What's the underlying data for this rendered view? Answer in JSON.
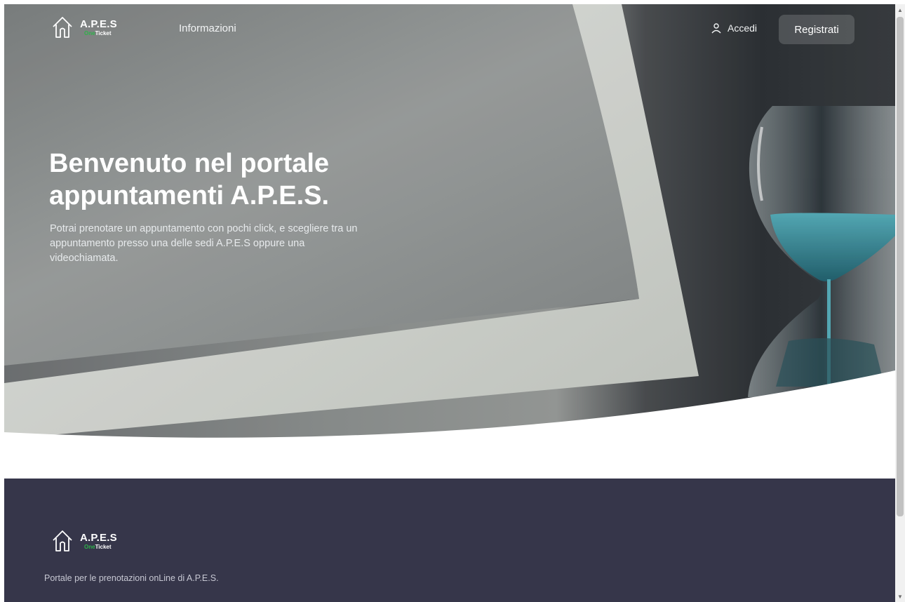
{
  "header": {
    "brand": {
      "name": "A.P.E.S",
      "sub_one": "One",
      "sub_ticket": "Ticket"
    },
    "nav_link": "Informazioni",
    "login_label": "Accedi",
    "register_label": "Registrati"
  },
  "hero": {
    "title_line1": "Benvenuto nel portale",
    "title_line2": "appuntamenti A.P.E.S.",
    "description": "Potrai prenotare un appuntamento con pochi click, e scegliere tra un appuntamento presso una delle sedi A.P.E.S oppure una videochiamata."
  },
  "footer": {
    "brand": {
      "name": "A.P.E.S",
      "sub_one": "One",
      "sub_ticket": "Ticket"
    },
    "description": "Portale per le prenotazioni onLine di A.P.E.S."
  },
  "colors": {
    "accent_green": "#2fb24a",
    "footer_bg": "#36364a",
    "text_white": "#ffffff"
  },
  "icons": {
    "logo": "house-outline-icon",
    "login": "user-icon",
    "scroll_up": "chevron-up-icon",
    "scroll_down": "chevron-down-icon"
  }
}
